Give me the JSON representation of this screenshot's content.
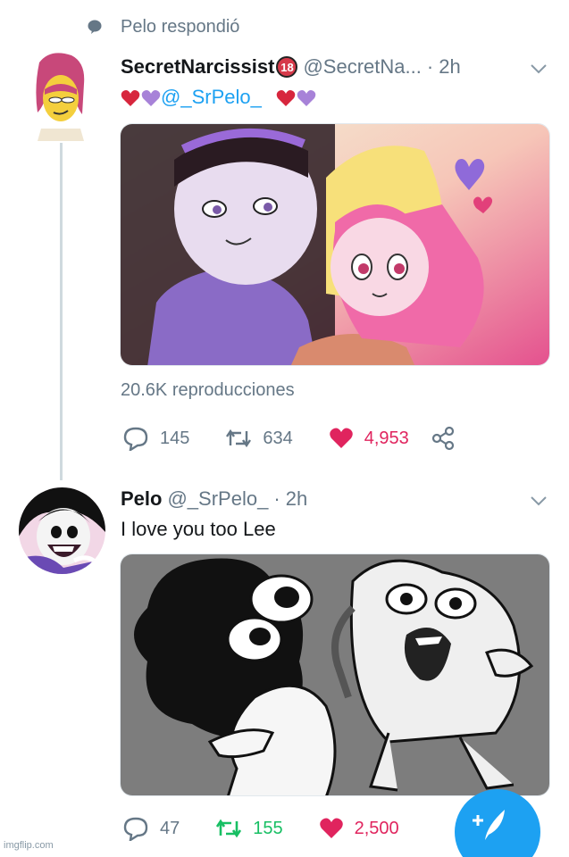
{
  "context": {
    "text": "Pelo respondió",
    "icon": "speech-bubble-icon"
  },
  "tweet1": {
    "name": "SecretNarcissist",
    "badge": "18",
    "handle": "@SecretNa...",
    "time": "· 2h",
    "mention": "@_SrPelo_",
    "views": "20.6K reproducciones",
    "replies": "145",
    "retweets": "634",
    "likes": "4,953"
  },
  "tweet2": {
    "name": "Pelo",
    "handle": "@_SrPelo_",
    "time": "· 2h",
    "text": "I love you too Lee",
    "replies": "47",
    "retweets": "155",
    "likes": "2,500"
  },
  "watermark": "imgflip.com",
  "colors": {
    "accent": "#1da1f2",
    "like": "#e0245e",
    "retweet": "#17bf63",
    "muted": "#657786",
    "heart_red": "#d7263d",
    "heart_purple": "#a782d8"
  }
}
